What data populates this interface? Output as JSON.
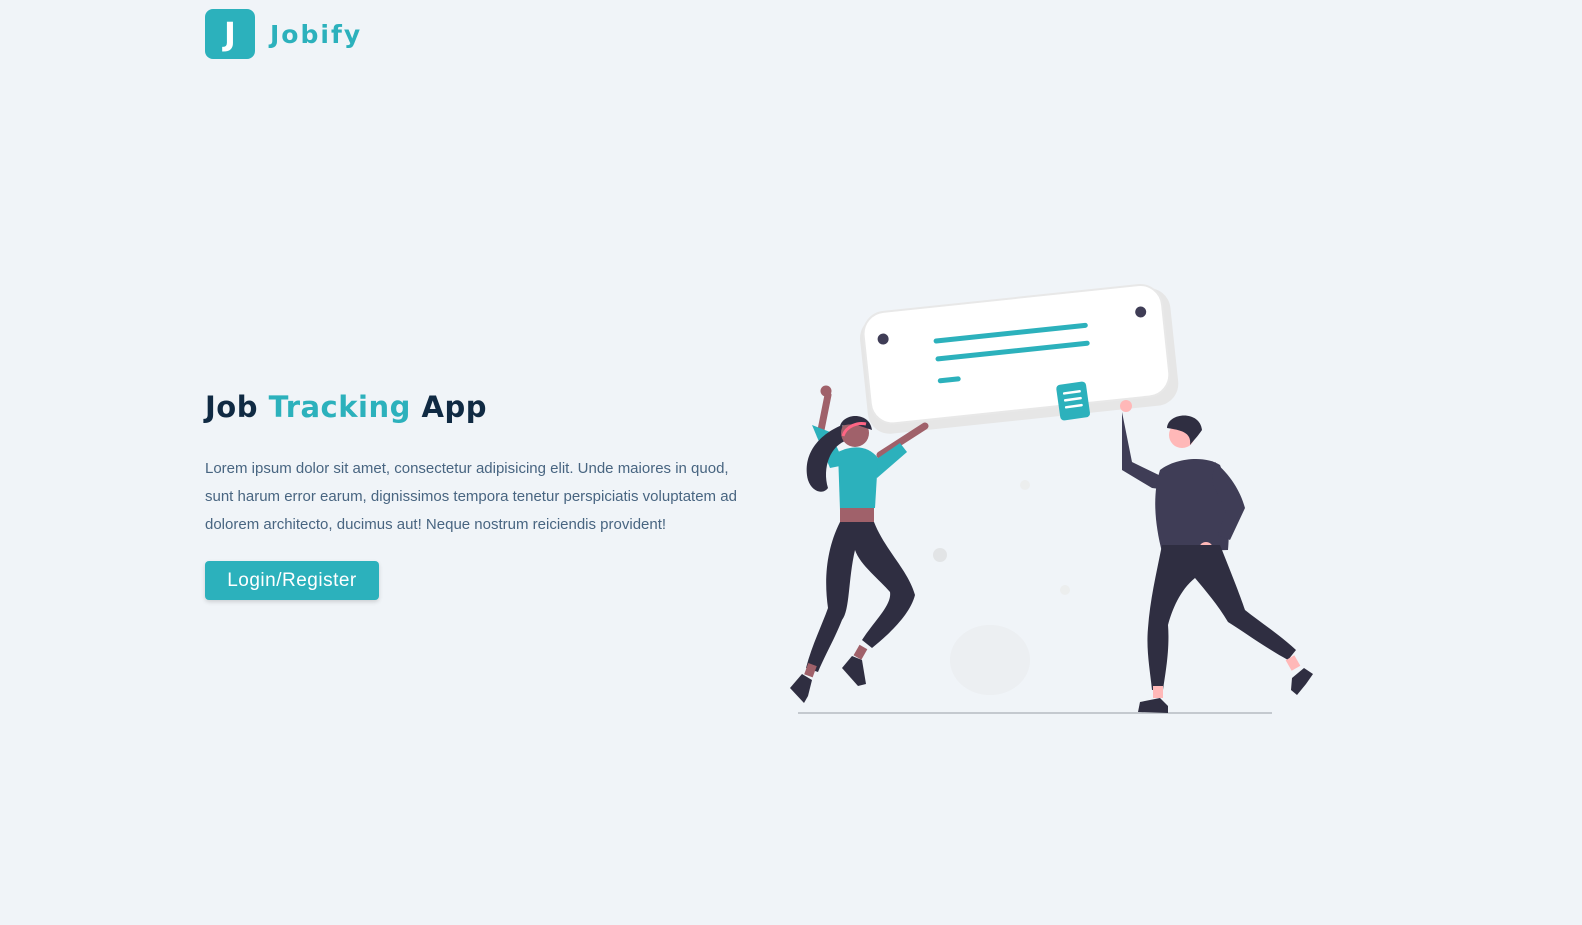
{
  "brand": {
    "logo_letter": "J",
    "name": "Jobify",
    "color": "#2cb1bc"
  },
  "hero": {
    "title_part1": "Job",
    "title_accent": "Tracking",
    "title_part2": "App",
    "description": "Lorem ipsum dolor sit amet, consectetur adipisicing elit. Unde maiores in quod, sunt harum error earum, dignissimos tempora tenetur perspiciatis voluptatem ad dolorem architecto, ducimus aut! Neque nostrum reiciendis provident!",
    "cta_label": "Login/Register"
  },
  "illustration": {
    "name": "people-celebrating-job-card",
    "colors": {
      "accent": "#2cb1bc",
      "dark": "#3f3d56",
      "skin_woman": "#a0616a",
      "skin_man": "#ffb8b8"
    }
  }
}
